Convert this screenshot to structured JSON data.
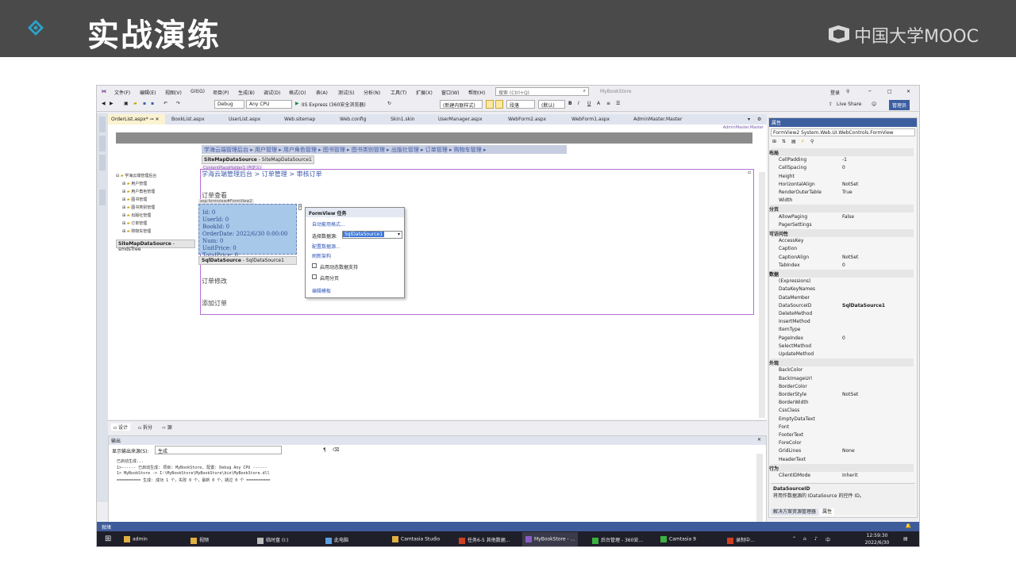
{
  "banner": {
    "title": "实战演练",
    "brand": "中国大学MOOC",
    "colors": {
      "background": "#4a4a4a",
      "diamond": "#2aa3c9"
    }
  },
  "vs": {
    "menu": {
      "items": [
        "文件(F)",
        "编辑(E)",
        "视图(V)",
        "Git(G)",
        "项目(P)",
        "生成(B)",
        "调试(D)",
        "格式(O)",
        "表(A)",
        "测试(S)",
        "分析(N)",
        "工具(T)",
        "扩展(X)",
        "窗口(W)",
        "帮助(H)"
      ],
      "search_placeholder": "搜索 (Ctrl+Q)",
      "solution_name": "MyBookStore",
      "signin": "登录",
      "admin_badge": "管理员"
    },
    "toolbar": {
      "config": "Debug",
      "platform": "Any CPU",
      "run": "IIS Express (360安全浏览器)",
      "block_format": "(新建内联样式)",
      "paragraph": "段落",
      "font": "(默认)",
      "live_share": "Live Share"
    },
    "tabs": [
      "OrderList.aspx*",
      "BookList.aspx",
      "UserList.aspx",
      "Web.sitemap",
      "Web.config",
      "Skin1.skin",
      "UserManager.aspx",
      "WebForm2.aspx",
      "WebForm1.aspx",
      "AdminMaster.Master"
    ],
    "designer": {
      "master_label": "AdminMaster.Master",
      "menu_links": "学海云端管理后台 ▸ 用户管理 ▸ 用户角色管理 ▸ 图书管理 ▸ 图书类别管理 ▸ 出版社管理 ▸ 订单管理 ▸ 购物车管理 ▸",
      "sitemap_ds": "SiteMapDataSource",
      "sitemap_ds_id": "SiteMapDataSource1",
      "content_label": "ContentPlaceHolder1 (自定义)",
      "breadcrumb": "学海云端管理后台 > 订单管理 > 审核订单",
      "tree_root": "学海云端管理后台",
      "tree_items": [
        "用户管理",
        "用户角色管理",
        "图书管理",
        "图书类别管理",
        "出版社管理",
        "订单管理",
        "购物车管理"
      ],
      "sitemap_ds2": "SiteMapDataSource",
      "sitemap_ds2_id": "smdsTree",
      "section_view": "订单查看",
      "formview_tag": "asp:formview#FormView2",
      "formview_lines": [
        "Id: 0",
        "UserId: 0",
        "BookId: 0",
        "OrderDate: 2022/6/30 0:00:00",
        "Num: 0",
        "UnitPrice: 0",
        "TotalPrice: 0"
      ],
      "sql_ds": "SqlDataSource",
      "sql_ds_id": "SqlDataSource1",
      "section_edit": "订单修改",
      "section_add": "添加订单"
    },
    "tasks": {
      "title": "FormView 任务",
      "autoformat": "自动套用格式...",
      "choose_ds_label": "选择数据源:",
      "choose_ds_value": "SqlDataSource1",
      "configure_ds": "配置数据源...",
      "refresh_schema": "刷新架构",
      "enable_dynamic": "启用动态数据支持",
      "enable_paging": "启用分页",
      "edit_templates": "编辑模板"
    },
    "design_tabs": [
      "设计",
      "拆分",
      "源"
    ],
    "output": {
      "title": "输出",
      "source_label": "显示输出来源(S):",
      "source_value": "生成",
      "lines": [
        "已启动生成...",
        "1>------ 已启动生成: 项目: MyBookStore, 配置: Debug Any CPU ------",
        "1>  MyBookStore -> I:\\MyBookStore\\MyBookStore\\bin\\MyBookStore.dll",
        "========== 生成: 成功 1 个，失败 0 个，最新 0 个，跳过 0 个 =========="
      ]
    },
    "props": {
      "title": "属性",
      "object": "FormView2 System.Web.UI.WebControls.FormView",
      "rows": [
        {
          "cat": true,
          "n": "布局"
        },
        {
          "n": "CellPadding",
          "v": "-1"
        },
        {
          "n": "CellSpacing",
          "v": "0"
        },
        {
          "n": "Height",
          "v": ""
        },
        {
          "n": "HorizontalAlign",
          "v": "NotSet"
        },
        {
          "n": "RenderOuterTable",
          "v": "True"
        },
        {
          "n": "Width",
          "v": ""
        },
        {
          "cat": true,
          "n": "分页"
        },
        {
          "n": "AllowPaging",
          "v": "False"
        },
        {
          "n": "PagerSettings",
          "v": ""
        },
        {
          "cat": true,
          "n": "可访问性"
        },
        {
          "n": "AccessKey",
          "v": ""
        },
        {
          "n": "Caption",
          "v": ""
        },
        {
          "n": "CaptionAlign",
          "v": "NotSet"
        },
        {
          "n": "TabIndex",
          "v": "0"
        },
        {
          "cat": true,
          "n": "数据"
        },
        {
          "n": "(Expressions)",
          "v": ""
        },
        {
          "n": "DataKeyNames",
          "v": ""
        },
        {
          "n": "DataMember",
          "v": ""
        },
        {
          "n": "DataSourceID",
          "v": "SqlDataSource1"
        },
        {
          "n": "DeleteMethod",
          "v": ""
        },
        {
          "n": "InsertMethod",
          "v": ""
        },
        {
          "n": "ItemType",
          "v": ""
        },
        {
          "n": "PageIndex",
          "v": "0"
        },
        {
          "n": "SelectMethod",
          "v": ""
        },
        {
          "n": "UpdateMethod",
          "v": ""
        },
        {
          "cat": true,
          "n": "外观"
        },
        {
          "n": "BackColor",
          "v": ""
        },
        {
          "n": "BackImageUrl",
          "v": ""
        },
        {
          "n": "BorderColor",
          "v": ""
        },
        {
          "n": "BorderStyle",
          "v": "NotSet"
        },
        {
          "n": "BorderWidth",
          "v": ""
        },
        {
          "n": "CssClass",
          "v": ""
        },
        {
          "n": "EmptyDataText",
          "v": ""
        },
        {
          "n": "Font",
          "v": ""
        },
        {
          "n": "FooterText",
          "v": ""
        },
        {
          "n": "ForeColor",
          "v": ""
        },
        {
          "n": "GridLines",
          "v": "None"
        },
        {
          "n": "HeaderText",
          "v": ""
        },
        {
          "cat": true,
          "n": "行为"
        },
        {
          "n": "ClientIDMode",
          "v": "Inherit"
        }
      ],
      "desc_title": "DataSourceID",
      "desc_text": "将用作数据源的 IDataSource 的控件 ID。",
      "tab_solution": "解决方案资源管理器",
      "tab_props": "属性"
    },
    "status": "就绪",
    "taskbar": {
      "items": [
        "admin",
        "视频",
        "临时盘 (I:)",
        "此电脑",
        "Camtasia Studio",
        "任务6-5 其他数据...",
        "MyBookStore - ...",
        "后台管理 - 360安...",
        "Camtasia 9",
        "录制中..."
      ],
      "time": "12:59:30",
      "date": "2022/6/30",
      "ime": "中"
    }
  }
}
